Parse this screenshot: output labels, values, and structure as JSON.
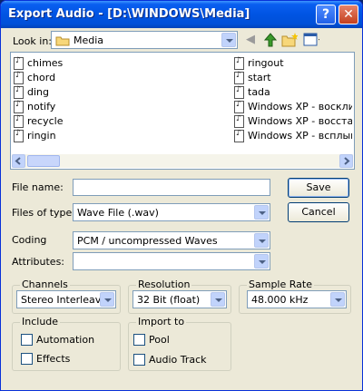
{
  "window": {
    "title": "Export Audio - [D:\\WINDOWS\\Media]"
  },
  "lookin": {
    "label": "Look in:",
    "folder": "Media"
  },
  "files": {
    "col1": [
      "chimes",
      "chord",
      "ding",
      "notify",
      "recycle",
      "ringin"
    ],
    "col2": [
      "ringout",
      "start",
      "tada",
      "Windows XP - восклицани",
      "Windows XP - восстановл",
      "Windows XP - всплывающ"
    ]
  },
  "form": {
    "filename_label": "File name:",
    "filename_value": "",
    "filetype_label": "Files of type:",
    "filetype_value": "Wave File (.wav)",
    "coding_label": "Coding",
    "coding_value": "PCM / uncompressed Waves",
    "attributes_label": "Attributes:",
    "attributes_value": ""
  },
  "buttons": {
    "save": "Save",
    "cancel": "Cancel"
  },
  "channels": {
    "title": "Channels",
    "value": "Stereo Interleaved"
  },
  "resolution": {
    "title": "Resolution",
    "value": "32 Bit (float)"
  },
  "samplerate": {
    "title": "Sample Rate",
    "value": "48.000 kHz"
  },
  "include": {
    "title": "Include",
    "automation": "Automation",
    "effects": "Effects"
  },
  "importto": {
    "title": "Import to",
    "pool": "Pool",
    "audiotrack": "Audio Track"
  }
}
